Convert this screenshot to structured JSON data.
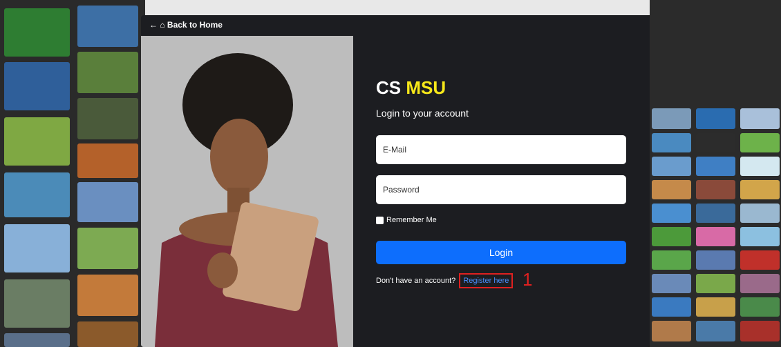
{
  "nav": {
    "back_label": "← ⌂ Back to Home"
  },
  "brand": {
    "part1": "CS ",
    "part2": "MSU",
    "accent_color": "#f7e81a"
  },
  "form": {
    "subtitle": "Login to your account",
    "email_placeholder": "E-Mail",
    "password_placeholder": "Password",
    "remember_label": "Remember Me",
    "login_label": "Login",
    "register_prompt": "Don't have an account?",
    "register_link": "Register here"
  },
  "annotation": {
    "marker": "1",
    "color": "#e02020"
  },
  "colors": {
    "card_bg": "#1c1d21",
    "button": "#0d6efd",
    "link": "#4a90ff"
  }
}
